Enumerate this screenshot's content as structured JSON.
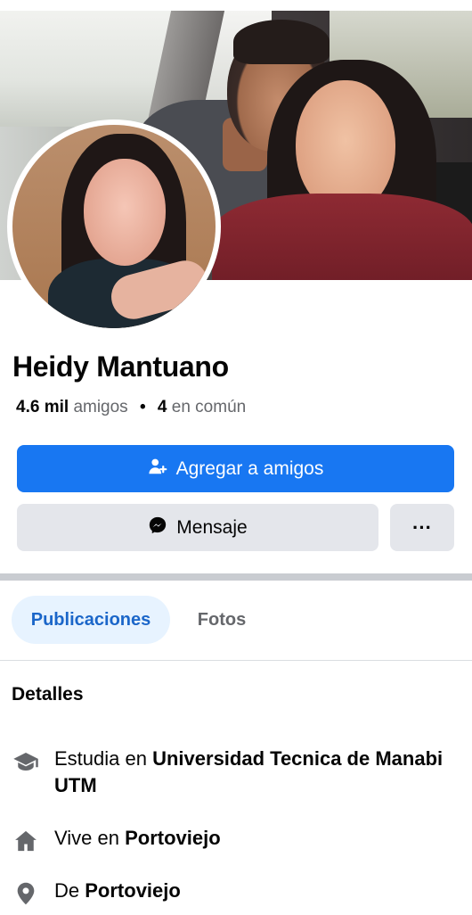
{
  "profile": {
    "name": "Heidy Mantuano",
    "friends_count": "4.6 mil",
    "friends_label": "amigos",
    "separator": "•",
    "mutual_count": "4",
    "mutual_label": "en común"
  },
  "actions": {
    "add_friend_label": "Agregar a amigos",
    "message_label": "Mensaje",
    "more_label": "···"
  },
  "tabs": [
    {
      "label": "Publicaciones",
      "active": true
    },
    {
      "label": "Fotos",
      "active": false
    }
  ],
  "details": {
    "title": "Detalles",
    "items": [
      {
        "icon": "graduation-cap-icon",
        "prefix": "Estudia en",
        "value": "Universidad Tecnica de Manabi UTM"
      },
      {
        "icon": "home-icon",
        "prefix": "Vive en",
        "value": "Portoviejo"
      },
      {
        "icon": "location-pin-icon",
        "prefix": "De",
        "value": "Portoviejo"
      }
    ]
  },
  "colors": {
    "primary": "#1877f2",
    "secondary_bg": "#e4e6eb",
    "active_tab_bg": "#e7f3ff",
    "active_tab_text": "#1b66c9",
    "muted_text": "#65676b",
    "icon_gray": "#65676b"
  }
}
